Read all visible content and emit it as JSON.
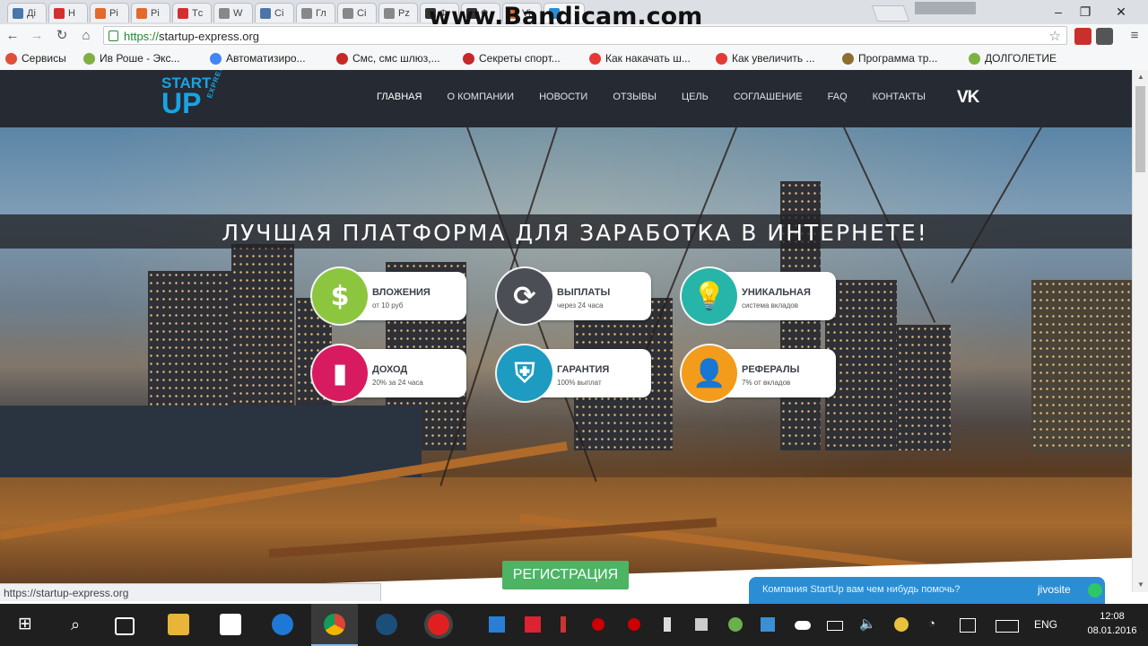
{
  "browser": {
    "tabs": [
      {
        "label": "Дi",
        "color": "#4a76a8"
      },
      {
        "label": "Н",
        "color": "#d32f2f"
      },
      {
        "label": "Рі",
        "color": "#e26a2c"
      },
      {
        "label": "Рі",
        "color": "#e26a2c"
      },
      {
        "label": "Тc",
        "color": "#d32f2f"
      },
      {
        "label": "W",
        "color": "#888888"
      },
      {
        "label": "Сi",
        "color": "#4a76a8"
      },
      {
        "label": "Гл",
        "color": "#888888"
      },
      {
        "label": "Сi",
        "color": "#888888"
      },
      {
        "label": "Рz",
        "color": "#888888"
      },
      {
        "label": "Ф",
        "color": "#333333"
      },
      {
        "label": "Ф",
        "color": "#333333"
      },
      {
        "label": "Vi",
        "color": "#e26a2c"
      },
      {
        "label": "",
        "color": "#2a8ed4"
      }
    ],
    "watermark": "www.Bandicam.com",
    "profile_label": "",
    "url_scheme": "https://",
    "url_host": "startup-express.org",
    "bookmarks": [
      {
        "label": "Сервисы",
        "color": "#e04f3a"
      },
      {
        "label": "Ив Роше - Экс...",
        "color": "#7fb040"
      },
      {
        "label": "Автоматизиро...",
        "color": "#4285f4"
      },
      {
        "label": "Смс, смс шлюз,...",
        "color": "#c62828"
      },
      {
        "label": "Секреты спорт...",
        "color": "#c62828"
      },
      {
        "label": "Как накачать ш...",
        "color": "#e53935"
      },
      {
        "label": "Как увеличить ...",
        "color": "#e53935"
      },
      {
        "label": "Программа тр...",
        "color": "#8d6e2f"
      },
      {
        "label": "ДОЛГОЛЕТИЕ",
        "color": "#7cb342"
      }
    ]
  },
  "site": {
    "logo": {
      "line1": "START",
      "line2": "UP",
      "line3": "EXPRESS"
    },
    "menu": [
      "ГЛАВНАЯ",
      "О КОМПАНИИ",
      "НОВОСТИ",
      "ОТЗЫВЫ",
      "ЦЕЛЬ",
      "СОГЛАШЕНИЕ",
      "FAQ",
      "КОНТАКТЫ"
    ],
    "vk_label": "VK",
    "headline": "ЛУЧШАЯ ПЛАТФОРМА ДЛЯ ЗАРАБОТКА В ИНТЕРНЕТЕ!",
    "features": [
      {
        "title": "ВЛОЖЕНИЯ",
        "subtitle": "от 10 руб",
        "color": "#8cc63f",
        "icon": "dollar-icon",
        "glyph": "$"
      },
      {
        "title": "ВЫПЛАТЫ",
        "subtitle": "через 24 часа",
        "color": "#4b4f55",
        "icon": "refresh-icon",
        "glyph": "⟳"
      },
      {
        "title": "УНИКАЛЬНАЯ",
        "subtitle": "система вкладов",
        "color": "#26b5a8",
        "icon": "lightbulb-icon",
        "glyph": "💡"
      },
      {
        "title": "ДОХОД",
        "subtitle": "20% за 24 часа",
        "color": "#d81b60",
        "icon": "bar-chart-icon",
        "glyph": "▮"
      },
      {
        "title": "ГАРАНТИЯ",
        "subtitle": "100% выплат",
        "color": "#1e9bc1",
        "icon": "shield-icon",
        "glyph": "⛨"
      },
      {
        "title": "РЕФЕРАЛЫ",
        "subtitle": "7% от вкладов",
        "color": "#f39c1b",
        "icon": "user-icon",
        "glyph": "👤"
      }
    ],
    "register_label": "РЕГИСТРАЦИЯ"
  },
  "status_url": "https://startup-express.org",
  "chat": {
    "text": "Компания StartUp вам чем нибудь помочь?",
    "brand": "jivosite"
  },
  "taskbar": {
    "lang": "ENG",
    "time": "12:08",
    "date": "08.01.2016"
  }
}
